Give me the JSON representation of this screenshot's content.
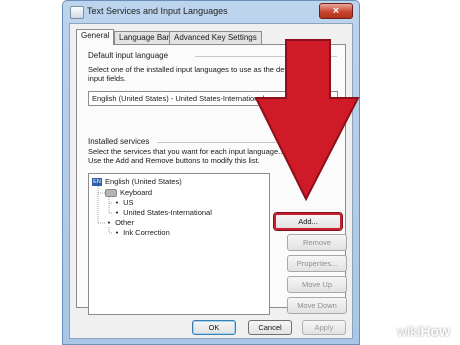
{
  "window": {
    "title": "Text Services and Input Languages",
    "close_glyph": "×"
  },
  "tabs": [
    {
      "label": "General",
      "active": true
    },
    {
      "label": "Language Bar",
      "active": false
    },
    {
      "label": "Advanced Key Settings",
      "active": false
    }
  ],
  "default_language": {
    "heading": "Default input language",
    "description": "Select one of the installed input languages to use as the default ... all input fields.",
    "selected": "English (United States) - United States-International"
  },
  "installed_services": {
    "heading": "Installed services",
    "description_line1": "Select the services that you want for each input language...",
    "description_line2": "Use the Add and Remove buttons to modify this list.",
    "tree": {
      "language_badge": "EN",
      "language": "English (United States)",
      "keyboard_label": "Keyboard",
      "keyboards": [
        "US",
        "United States-International"
      ],
      "other_label": "Other",
      "other_items": [
        "Ink Correction"
      ],
      "bullet": "•"
    },
    "buttons": {
      "add": "Add...",
      "remove": "Remove",
      "properties": "Properties...",
      "move_up": "Move Up",
      "move_down": "Move Down"
    }
  },
  "footer": {
    "ok": "OK",
    "cancel": "Cancel",
    "apply": "Apply"
  },
  "watermark": {
    "part1": "wiki",
    "part2": "How"
  },
  "colors": {
    "arrow": "#cf1b27",
    "highlight": "#c81e2d",
    "title_bar": "#bcd4ec"
  }
}
